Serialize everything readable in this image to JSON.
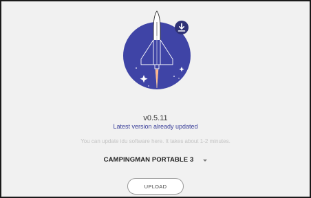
{
  "update": {
    "version": "v0.5.11",
    "status": "Latest version already updated",
    "hint": "You can update idu software here. It takes about 1-2 minutes."
  },
  "device": {
    "selected": "CAMPINGMAN PORTABLE 3"
  },
  "actions": {
    "upload_label": "UPLOAD"
  },
  "icons": {
    "illustration": "rocket-icon",
    "badge": "download-icon",
    "dropdown": "chevron-down-icon"
  },
  "colors": {
    "circle": "#3f44a6",
    "status_text": "#3a3f9a",
    "background": "#f1f1f1"
  }
}
